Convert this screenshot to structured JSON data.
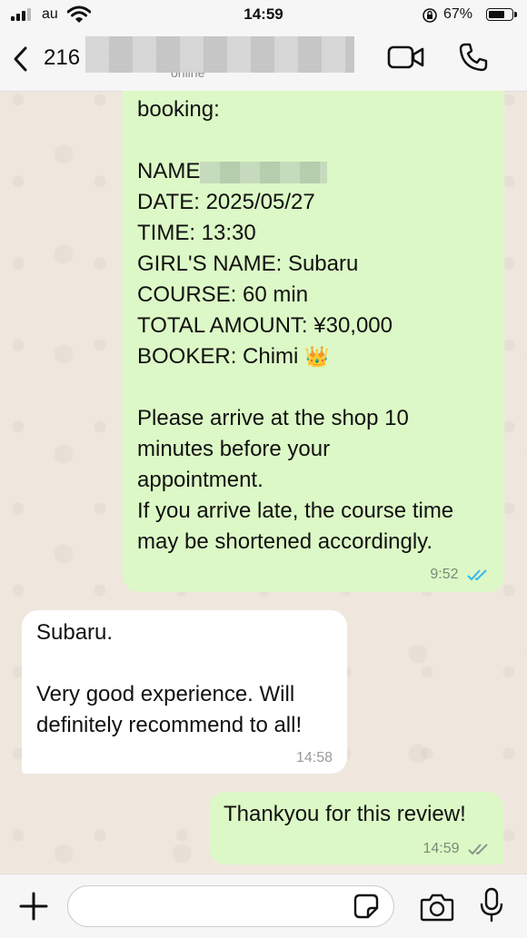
{
  "status": {
    "carrier": "au",
    "time": "14:59",
    "battery": "67%",
    "battery_level": 0.67
  },
  "header": {
    "contact_name": "216",
    "status_text": "online"
  },
  "messages": [
    {
      "lines": [
        "booking:",
        "",
        "NAME",
        "DATE: 2025/05/27",
        "TIME: 13:30",
        "GIRL'S NAME: Subaru",
        "COURSE: 60 min",
        "TOTAL AMOUNT: ¥30,000",
        "BOOKER: Chimi",
        "",
        "Please arrive at the shop 10",
        "minutes before your",
        "appointment.",
        "If you arrive late, the course time",
        "may be shortened accordingly."
      ],
      "emoji": "👑",
      "time": "9:52",
      "direction": "outgoing",
      "read": true
    },
    {
      "lines": [
        "Subaru.",
        "",
        "Very good experience. Will",
        "definitely recommend to all!"
      ],
      "time": "14:58",
      "direction": "incoming"
    },
    {
      "lines": [
        "Thankyou for this review!"
      ],
      "time": "14:59",
      "direction": "outgoing",
      "read": false
    }
  ],
  "colors": {
    "outgoing_bubble": "#dcf8c6",
    "incoming_bubble": "#ffffff",
    "read_tick": "#34b7f1",
    "chat_bg": "#efe7de"
  },
  "icons": [
    "back-chevron-icon",
    "video-call-icon",
    "phone-icon",
    "plus-icon",
    "sticker-icon",
    "camera-icon",
    "microphone-icon"
  ]
}
